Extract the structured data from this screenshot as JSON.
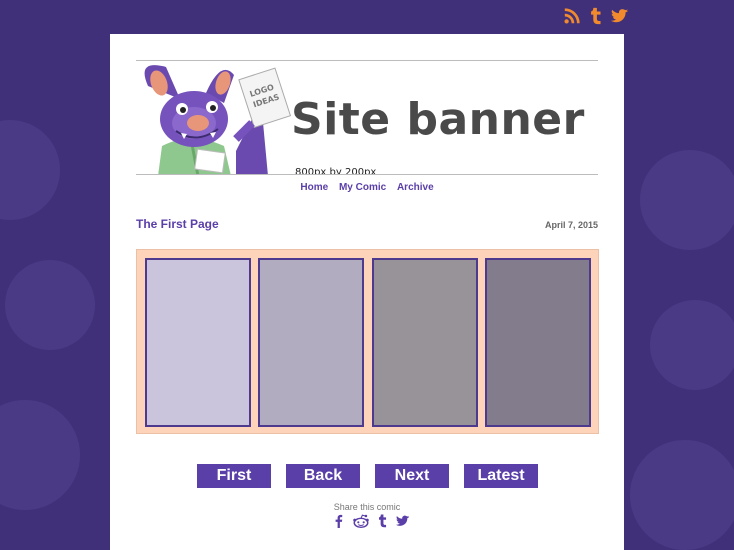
{
  "social_top": [
    "rss-icon",
    "tumblr-icon",
    "twitter-icon"
  ],
  "banner": {
    "title": "Site banner",
    "subtitle": "800px by 200px",
    "sign_text": [
      "LOGO",
      "IDEAS"
    ]
  },
  "nav": {
    "home": "Home",
    "my_comic": "My Comic",
    "archive": "Archive"
  },
  "post": {
    "title": "The First Page",
    "date": "April 7, 2015"
  },
  "comic": {
    "panel_count": 4
  },
  "comic_nav": {
    "first": "First",
    "back": "Back",
    "next": "Next",
    "latest": "Latest"
  },
  "share": {
    "label": "Share this comic",
    "icons": [
      "facebook-icon",
      "reddit-icon",
      "tumblr-icon",
      "twitter-icon"
    ]
  },
  "colors": {
    "background": "#40307a",
    "accent": "#5b3fa8",
    "social_orange": "#f08a2c",
    "comic_bg": "#fdd3ba",
    "panel_border": "#4d3a8e",
    "panels": [
      "#cac4dc",
      "#b1acbf",
      "#989399",
      "#827c8c"
    ]
  }
}
